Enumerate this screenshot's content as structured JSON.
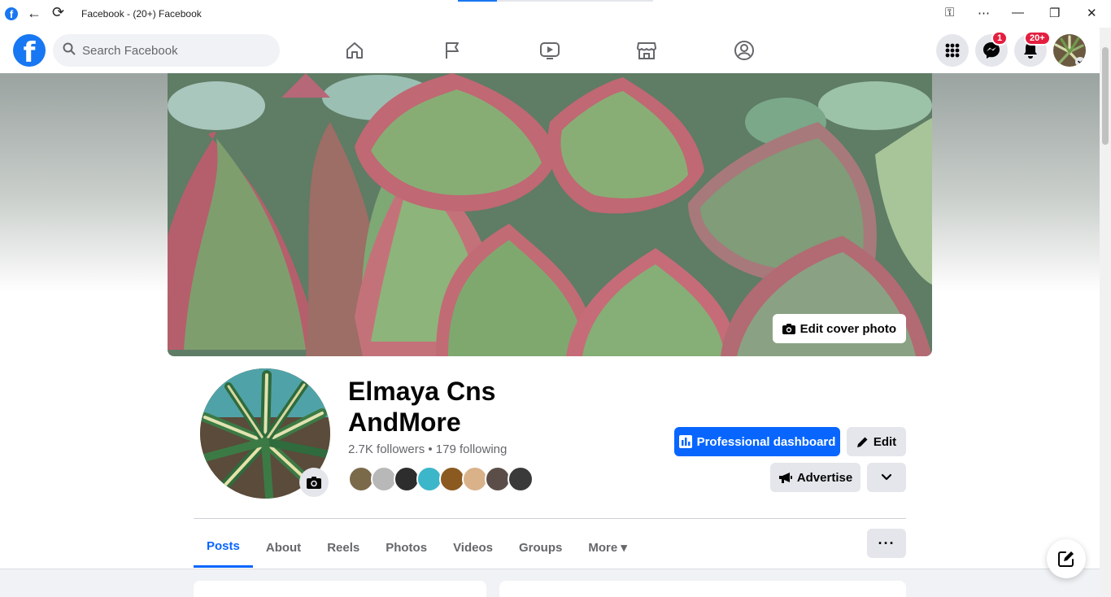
{
  "browser": {
    "title": "Facebook - (20+) Facebook",
    "icons": [
      "facebook-favicon",
      "back-arrow-icon",
      "reload-icon",
      "key-icon",
      "more-horizontal-icon",
      "minimize-icon",
      "restore-icon",
      "close-icon"
    ]
  },
  "header": {
    "logo": "f",
    "search_placeholder": "Search Facebook",
    "nav_icons": [
      "home-icon",
      "flag-icon",
      "video-icon",
      "marketplace-icon",
      "groups-icon"
    ],
    "messenger_badge": "1",
    "notifications_badge": "20+"
  },
  "cover": {
    "edit_label": "Edit cover photo"
  },
  "profile": {
    "name_line1": "Elmaya Cns",
    "name_line2": "AndMore",
    "stats": "2.7K followers • 179 following",
    "friend_colors": [
      "#7a6a4a",
      "#b8b8b8",
      "#2d2d2d",
      "#3cb6c9",
      "#8a5a20",
      "#d9b28a",
      "#5b4e48",
      "#3a3a3a"
    ]
  },
  "actions": {
    "professional_dashboard": "Professional dashboard",
    "edit": "Edit",
    "advertise": "Advertise"
  },
  "tabs": [
    {
      "label": "Posts",
      "active": true
    },
    {
      "label": "About",
      "active": false
    },
    {
      "label": "Reels",
      "active": false
    },
    {
      "label": "Photos",
      "active": false
    },
    {
      "label": "Videos",
      "active": false
    },
    {
      "label": "Groups",
      "active": false
    },
    {
      "label": "More ▾",
      "active": false
    }
  ],
  "colors": {
    "brand": "#1877f2",
    "primary_button": "#0866ff",
    "badge": "#e41e3f"
  }
}
